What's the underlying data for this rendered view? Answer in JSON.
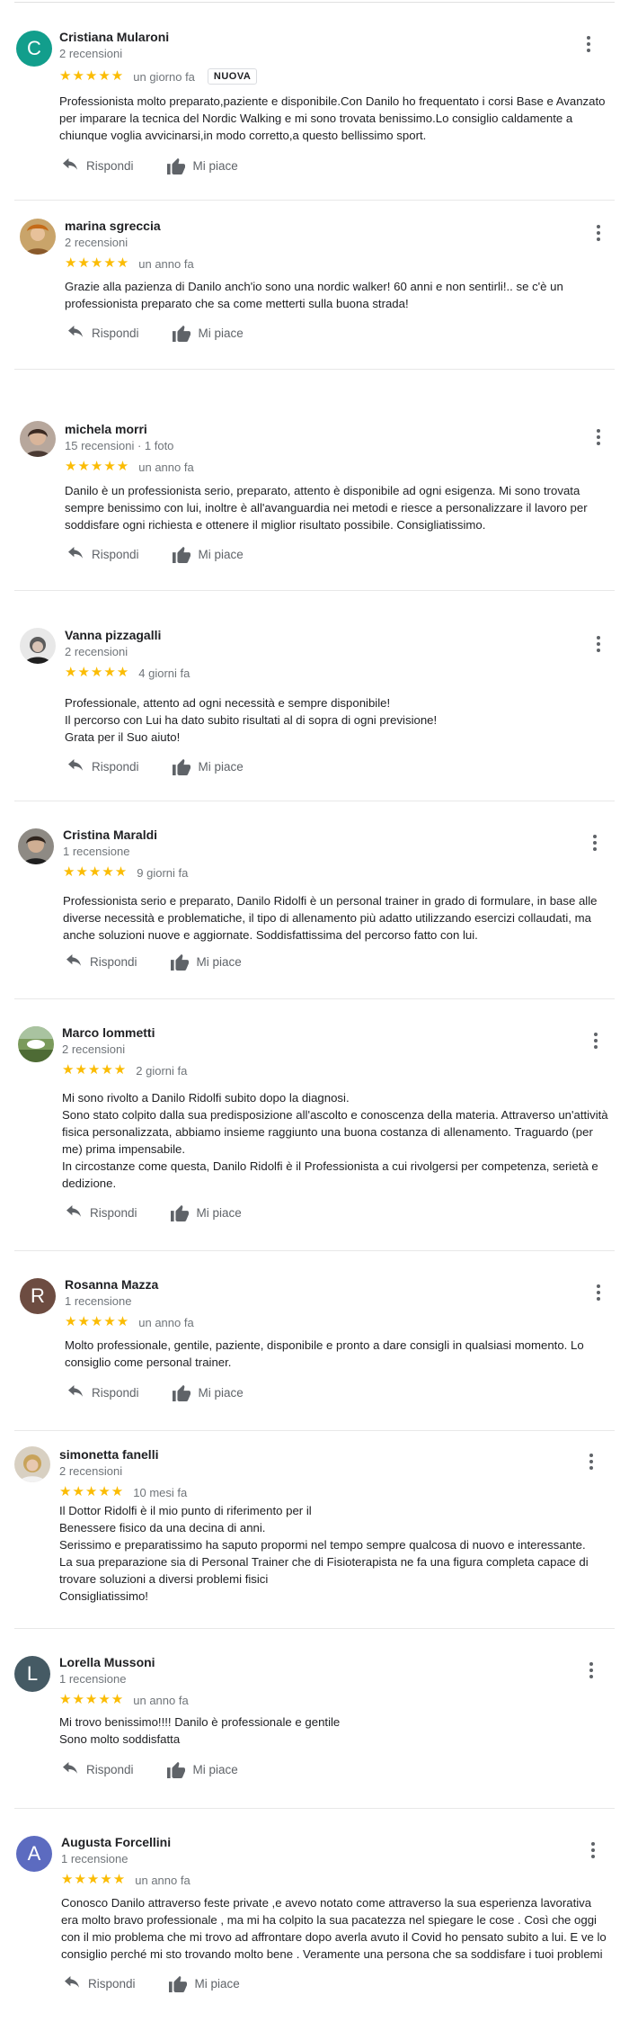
{
  "ui": {
    "reply_label": "Rispondi",
    "like_label": "Mi piace",
    "menu_icon": "more-vert-icon",
    "reply_icon": "reply-arrow-icon",
    "like_icon": "thumbs-up-icon",
    "star_color": "#fbbc04"
  },
  "reviews": [
    {
      "name": "Cristiana Mularoni",
      "meta": "2 recensioni",
      "stars": "★★★★★",
      "date": "un giorno fa",
      "badge": "NUOVA",
      "avatar_letter": "C",
      "avatar_color": "#129e8c",
      "lines": [
        "Professionista molto preparato,paziente e disponibile.Con Danilo ho frequentato i corsi Base e Avanzato",
        "per imparare la tecnica del Nordic Walking e mi sono trovata benissimo.Lo consiglio caldamente a",
        "chiunque voglia avvicinarsi,in modo corretto,a questo bellissimo sport."
      ]
    },
    {
      "name": "marina sgreccia",
      "meta": "2 recensioni",
      "stars": "★★★★★",
      "date": "un anno fa",
      "lines": [
        "Grazie alla pazienza di Danilo anch'io sono una nordic walker! 60 anni e non sentirli!.. se c'è un",
        "professionista preparato che sa come metterti sulla buona strada!"
      ]
    },
    {
      "name": "michela morri",
      "meta": "15 recensioni · 1 foto",
      "stars": "★★★★★",
      "date": "un anno fa",
      "lines": [
        "Danilo è un professionista serio, preparato, attento è disponibile ad ogni esigenza. Mi sono trovata",
        "sempre benissimo con lui, inoltre è all'avanguardia nei metodi e riesce a personalizzare il lavoro per",
        "soddisfare ogni richiesta e ottenere il miglior risultato possibile. Consigliatissimo."
      ]
    },
    {
      "name": "Vanna pizzagalli",
      "meta": "2 recensioni",
      "stars": "★★★★★",
      "date": "4 giorni fa",
      "lines": [
        "Professionale, attento ad ogni necessità e sempre disponibile!",
        "Il percorso con Lui ha dato subito risultati al di sopra di ogni previsione!",
        "Grata per il Suo aiuto!"
      ]
    },
    {
      "name": "Cristina Maraldi",
      "meta": "1 recensione",
      "stars": "★★★★★",
      "date": "9 giorni fa",
      "lines": [
        "Professionista serio e preparato, Danilo Ridolfi è un personal trainer in grado di  formulare, in base alle",
        "diverse necessità e problematiche, il tipo di allenamento più adatto utilizzando esercizi collaudati, ma",
        "anche soluzioni nuove e aggiornate. Soddisfattissima del percorso fatto con lui."
      ]
    },
    {
      "name": "Marco lommetti",
      "meta": "2 recensioni",
      "stars": "★★★★★",
      "date": "2  giorni fa",
      "lines": [
        "Mi sono rivolto a Danilo Ridolfi subito dopo la diagnosi.",
        "Sono stato colpito dalla sua predisposizione all'ascolto e conoscenza della materia. Attraverso un'attività",
        "fisica personalizzata, abbiamo insieme raggiunto una buona costanza di allenamento. Traguardo (per",
        "me) prima impensabile.",
        "In circostanze come questa, Danilo Ridolfi è il Professionista a cui rivolgersi per competenza, serietà e",
        "dedizione."
      ]
    },
    {
      "name": "Rosanna Mazza",
      "meta": "1 recensione",
      "stars": "★★★★★",
      "date": "un anno fa",
      "avatar_letter": "R",
      "avatar_color": "#6d4c41",
      "lines": [
        "Molto professionale, gentile, paziente, disponibile e pronto a dare consigli in qualsiasi momento. Lo",
        "consiglio come personal trainer."
      ]
    },
    {
      "name": "simonetta fanelli",
      "meta": "2 recensioni",
      "stars": "★★★★★",
      "date": "10 mesi fa",
      "lines": [
        "Il Dottor Ridolfi è il mio punto di riferimento per il",
        "Benessere fisico da una decina di anni.",
        "Serissimo e preparatissimo ha saputo propormi nel tempo sempre qualcosa di nuovo e interessante.",
        "La sua preparazione sia di Personal Trainer che di Fisioterapista ne fa una figura completa capace di",
        "trovare soluzioni a diversi problemi fisici",
        "Consigliatissimo!"
      ]
    },
    {
      "name": "Lorella Mussoni",
      "meta": "1 recensione",
      "stars": "★★★★★",
      "date": "un anno fa",
      "avatar_letter": "L",
      "avatar_color": "#455a64",
      "lines": [
        "Mi trovo benissimo!!!! Danilo è professionale e gentile",
        "Sono molto soddisfatta"
      ]
    },
    {
      "name": "Augusta Forcellini",
      "meta": "1 recensione",
      "stars": "★★★★★",
      "date": "un anno fa",
      "avatar_letter": "A",
      "avatar_color": "#5c6bc0",
      "lines": [
        "Conosco Danilo attraverso feste private ,e avevo notato come attraverso la sua esperienza lavorativa",
        "era molto bravo professionale , ma mi ha colpito la sua pacatezza nel spiegare le cose . Così che oggi",
        "con il mio problema che mi trovo ad affrontare dopo averla avuto il Covid ho pensato subito a lui. E ve lo",
        "consiglio perché mi sto trovando molto bene . Veramente una persona che sa soddisfare i tuoi problemi"
      ]
    }
  ]
}
